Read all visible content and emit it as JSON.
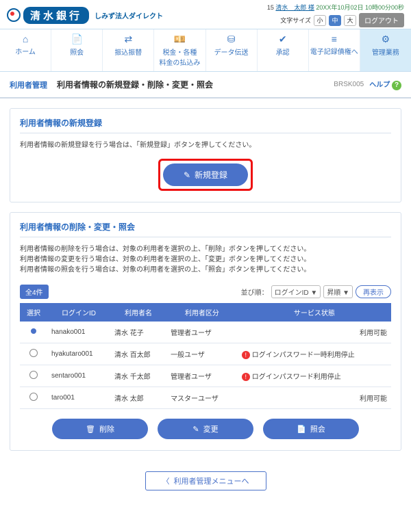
{
  "header": {
    "bank_name": "清水銀行",
    "sub_brand": "しみず法人ダイレクト",
    "user_prefix": "15",
    "user_name": "清水　太郎 様",
    "timestamp": "20XX年10月02日 10時00分00秒",
    "font_size_label": "文字サイズ",
    "font_small": "小",
    "font_medium": "中",
    "font_large": "大",
    "logout": "ログアウト"
  },
  "nav": {
    "home": "ホーム",
    "inquiry": "照会",
    "transfer": "振込振替",
    "tax": "税金・各種\n料金の払込み",
    "data": "データ伝送",
    "approve": "承認",
    "densai": "電子記録債権へ",
    "admin": "管理業務"
  },
  "breadcrumb": {
    "category": "利用者管理",
    "title": "利用者情報の新規登録・削除・変更・照会",
    "code": "BRSK005",
    "help": "ヘルプ"
  },
  "register": {
    "title": "利用者情報の新規登録",
    "desc": "利用者情報の新規登録を行う場合は、「新規登録」ボタンを押してください。",
    "btn": "新規登録"
  },
  "manage": {
    "title": "利用者情報の削除・変更・照会",
    "desc1": "利用者情報の削除を行う場合は、対象の利用者を選択の上、「削除」ボタンを押してください。",
    "desc2": "利用者情報の変更を行う場合は、対象の利用者を選択の上、「変更」ボタンを押してください。",
    "desc3": "利用者情報の照会を行う場合は、対象の利用者を選択の上、「照会」ボタンを押してください。",
    "count": "全4件",
    "sort_label": "並び順：",
    "sort_field": "ログインID",
    "sort_dir": "昇順",
    "refresh": "再表示",
    "cols": {
      "select": "選択",
      "login": "ログインID",
      "name": "利用者名",
      "role": "利用者区分",
      "status": "サービス状態"
    },
    "rows": [
      {
        "login": "hanako001",
        "name": "清水 花子",
        "role": "管理者ユーザ",
        "status": "利用可能",
        "warn": false,
        "checked": true
      },
      {
        "login": "hyakutaro001",
        "name": "清水 百太郎",
        "role": "一般ユーザ",
        "status": "ログインパスワード一時利用停止",
        "warn": true,
        "checked": false
      },
      {
        "login": "sentaro001",
        "name": "清水 千太郎",
        "role": "管理者ユーザ",
        "status": "ログインパスワード利用停止",
        "warn": true,
        "checked": false
      },
      {
        "login": "taro001",
        "name": "清水 太郎",
        "role": "マスターユーザ",
        "status": "利用可能",
        "warn": false,
        "checked": false
      }
    ],
    "delete": "削除",
    "edit": "変更",
    "view": "照会"
  },
  "back": "利用者管理メニューへ"
}
